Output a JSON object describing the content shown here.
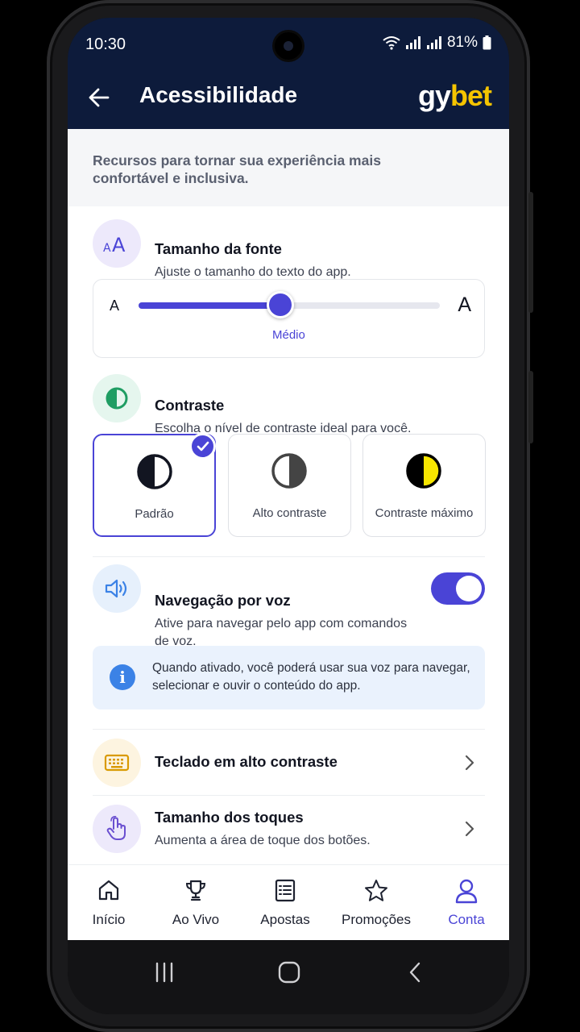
{
  "status": {
    "time": "10:30",
    "battery": "81%"
  },
  "header": {
    "title": "Acessibilidade",
    "logo_part1": "gy",
    "logo_part2": "bet"
  },
  "intro": "Recursos para tornar sua experiência mais confortável e inclusiva.",
  "font_size": {
    "title": "Tamanho da fonte",
    "subtitle": "Ajuste o tamanho do texto do app.",
    "small_a": "A",
    "large_a": "A",
    "level_label": "Médio",
    "level_fraction": 0.47
  },
  "contrast": {
    "title": "Contraste",
    "subtitle": "Escolha o nível de contraste ideal para você.",
    "options": [
      {
        "label": "Padrão",
        "selected": true
      },
      {
        "label": "Alto contraste",
        "selected": false
      },
      {
        "label": "Contraste máximo",
        "selected": false
      }
    ]
  },
  "voice": {
    "title": "Navegação por voz",
    "subtitle": "Ative para navegar pelo app com comandos de voz.",
    "enabled": true,
    "info": "Quando ativado, você poderá usar sua voz para navegar, selecionar e ouvir o conteúdo do app."
  },
  "keyboard": {
    "title": "Teclado em alto contraste"
  },
  "touch": {
    "title": "Tamanho dos toques",
    "subtitle": "Aumenta a área de toque dos botões."
  },
  "nav": {
    "items": [
      {
        "label": "Início",
        "icon": "home-icon"
      },
      {
        "label": "Ao Vivo",
        "icon": "trophy-icon"
      },
      {
        "label": "Apostas",
        "icon": "betslip-icon"
      },
      {
        "label": "Promoções",
        "icon": "star-icon"
      },
      {
        "label": "Conta",
        "icon": "user-icon",
        "active": true
      }
    ]
  },
  "colors": {
    "accent": "#4a44d6",
    "header_bg": "#0d1b3b",
    "logo_yellow": "#f5c400",
    "info_bg": "#eaf2fd"
  }
}
